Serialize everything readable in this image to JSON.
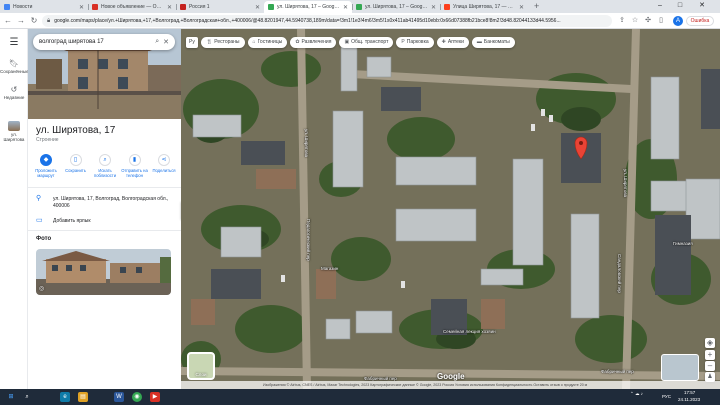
{
  "browser": {
    "tabs": [
      {
        "title": "Новости",
        "fav_color": "#4285f4",
        "active": false
      },
      {
        "title": "Новое объявление — Объявл...",
        "fav_color": "#d93025",
        "active": false
      },
      {
        "title": "Россия 1",
        "fav_color": "#c5221f",
        "active": false
      },
      {
        "title": "ул. Ширятова, 17 – Google К...",
        "fav_color": "#34a853",
        "active": true
      },
      {
        "title": "ул. Ширятова, 17 – Google К...",
        "fav_color": "#34a853",
        "active": false
      },
      {
        "title": "Улица Ширятова, 17 — Янде...",
        "fav_color": "#fc3f1d",
        "active": false
      }
    ],
    "url": "google.com/maps/place/ул.+Ширятова,+17,+Волгоград,+Волгоградская+обл.,+400006/@48.8201947,44.5940738,189m/data=!3m1!1e3!4m6!3m5!1s0x411ab41495d10ebb:0x66d07388fb21bce8!8m2!3d48.82044133d44.5956...",
    "error_label": "Ошибка",
    "profile_initial": "А"
  },
  "rail": {
    "items": [
      {
        "label": "Сохранённые",
        "icon": "bookmark-icon"
      },
      {
        "label": "Недавние",
        "icon": "history-icon"
      },
      {
        "label": "ул. Ширятова",
        "icon": "place-thumb"
      }
    ]
  },
  "panel": {
    "search_query": "волгоград ширятова 17",
    "title": "ул. Ширятова, 17",
    "type": "Строение",
    "actions": [
      {
        "label": "Проложить маршрут",
        "icon": "directions-icon"
      },
      {
        "label": "Сохранить",
        "icon": "bookmark-icon"
      },
      {
        "label": "Искать поблизости",
        "icon": "nearby-icon"
      },
      {
        "label": "Отправить на телефон",
        "icon": "phone-icon"
      },
      {
        "label": "Поделиться",
        "icon": "share-icon"
      }
    ],
    "address": "ул. Ширятова, 17, Волгоград, Волгоградская обл., 400006",
    "add_label": "Добавить ярлык",
    "photos_heading": "Фото"
  },
  "map": {
    "chips": [
      {
        "label": "Рестораны",
        "icon": "🍴"
      },
      {
        "label": "Гостиницы",
        "icon": "🛏"
      },
      {
        "label": "Развлечения",
        "icon": "✿"
      },
      {
        "label": "Общ. транспорт",
        "icon": "🚌"
      },
      {
        "label": "Парковка",
        "icon": "P"
      },
      {
        "label": "Аптеки",
        "icon": "✚"
      },
      {
        "label": "Банкоматы",
        "icon": "💳"
      }
    ],
    "street_labels": {
      "shiryatova": "ул. Ширятова",
      "shiryatova2": "ул. Ширятова",
      "sandalovsky": "Сандаловский пер",
      "pedagogich": "Педагогический пер",
      "fabrichny": "Фабричный пер",
      "fabrichny2": "Фабричный пер"
    },
    "poi_labels": {
      "store": "Магазин",
      "school": "Гимназия",
      "ochag": "Семейная лекция хозяин"
    },
    "layers_label": "Слои",
    "logo": "Google",
    "attribution": "Изображения © Airbus, CNES / Airbus, Maxar Technologies, 2023 Картографические данные © Google, 2023   Россия   Условия использования   Конфиденциальность   Оставить отзыв о продукте   20 м"
  },
  "taskbar": {
    "lang": "РУС",
    "time": "17:57",
    "date": "24.11.2023"
  }
}
